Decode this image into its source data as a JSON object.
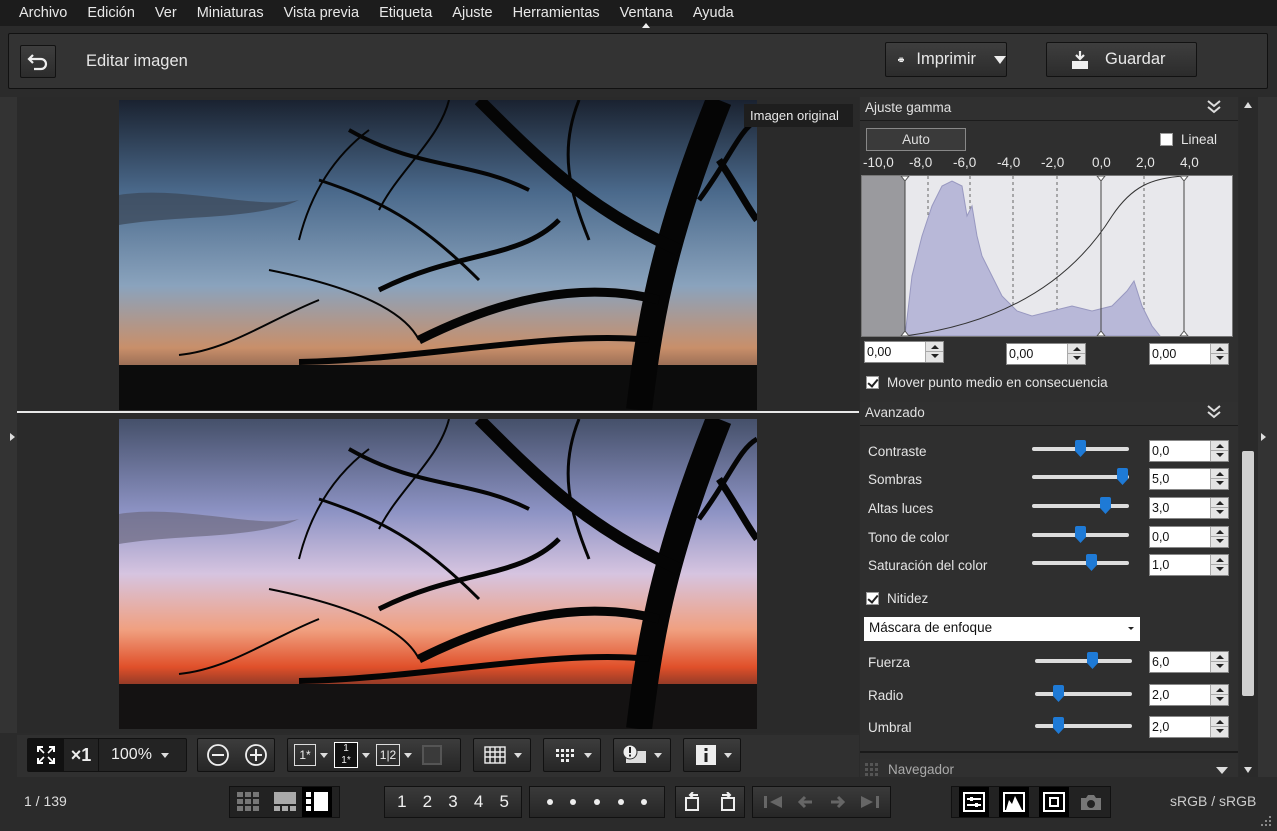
{
  "menu": [
    "Archivo",
    "Edición",
    "Ver",
    "Miniaturas",
    "Vista previa",
    "Etiqueta",
    "Ajuste",
    "Herramientas",
    "Ventana",
    "Ayuda"
  ],
  "toolbar": {
    "title": "Editar imagen",
    "print_label": "Imprimir",
    "save_label": "Guardar"
  },
  "viewer": {
    "original_label": "Imagen original"
  },
  "gamma": {
    "section": "Ajuste gamma",
    "auto_label": "Auto",
    "linear_label": "Lineal",
    "linear_checked": false,
    "ticks": [
      "-10,0",
      "-8,0",
      "-6,0",
      "-4,0",
      "-2,0",
      "0,0",
      "2,0",
      "4,0"
    ],
    "values": [
      "0,00",
      "0,00",
      "0,00"
    ],
    "midpoint_label": "Mover punto medio en consecuencia",
    "midpoint_checked": true
  },
  "advanced": {
    "section": "Avanzado",
    "sliders": [
      {
        "label": "Contraste",
        "value": "0,0",
        "position": 0.5
      },
      {
        "label": "Sombras",
        "value": "5,0",
        "position": 0.93
      },
      {
        "label": "Altas luces",
        "value": "3,0",
        "position": 0.76
      },
      {
        "label": "Tono de color",
        "value": "0,0",
        "position": 0.5
      },
      {
        "label": "Saturación del color",
        "value": "1,0",
        "position": 0.61
      }
    ],
    "sharpness_label": "Nitidez",
    "sharpness_checked": true,
    "sharpness_mode": "Máscara de enfoque",
    "sharp_sliders": [
      {
        "label": "Fuerza",
        "value": "6,0",
        "position": 0.6
      },
      {
        "label": "Radio",
        "value": "2,0",
        "position": 0.22
      },
      {
        "label": "Umbral",
        "value": "2,0",
        "position": 0.22
      }
    ]
  },
  "navigator": {
    "label": "Navegador"
  },
  "bottom": {
    "x1": "×1",
    "zoom": "100%"
  },
  "thumbs": {
    "ratings": [
      "1",
      "2",
      "3",
      "4",
      "5"
    ]
  },
  "status": {
    "counter": "1 / 139",
    "colorspace": "sRGB / sRGB"
  },
  "colors": {
    "accent": "#1e7ad6",
    "panel": "#2f2f2f",
    "menubar": "#1c1c1c"
  }
}
